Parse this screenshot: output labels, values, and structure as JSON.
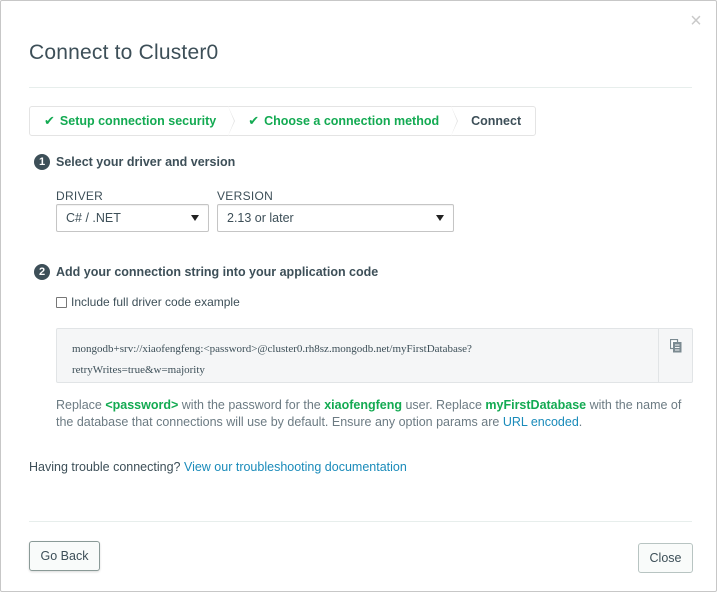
{
  "modal": {
    "title": "Connect to Cluster0",
    "close_glyph": "×"
  },
  "breadcrumb": {
    "items": [
      {
        "label": "Setup connection security",
        "done": true
      },
      {
        "label": "Choose a connection method",
        "done": true
      },
      {
        "label": "Connect",
        "done": false
      }
    ],
    "check_glyph": "✔"
  },
  "step1": {
    "number": "1",
    "label": "Select your driver and version",
    "driver_label": "DRIVER",
    "driver_value": "C# / .NET",
    "version_label": "VERSION",
    "version_value": "2.13 or later"
  },
  "step2": {
    "number": "2",
    "label": "Add your connection string into your application code",
    "checkbox_label": "Include full driver code example",
    "checkbox_checked": false,
    "connection_string_line1": "mongodb+srv://xiaofengfeng:<password>@cluster0.rh8sz.mongodb.net/myFirstDatabase?",
    "connection_string_line2": "retryWrites=true&w=majority",
    "copy_icon": "copy-icon"
  },
  "description": {
    "p1": "Replace ",
    "password_token": "<password>",
    "p2": " with the password for the ",
    "user": "xiaofengfeng",
    "p3": " user. Replace ",
    "db": "myFirstDatabase",
    "p4": " with the name of the database that connections will use by default. Ensure any option params are ",
    "url_link": "URL encoded",
    "p5": "."
  },
  "trouble": {
    "text": "Having trouble connecting? ",
    "link": "View our troubleshooting documentation"
  },
  "footer": {
    "back_label": "Go Back",
    "close_label": "Close"
  },
  "colors": {
    "green": "#13aa52",
    "link": "#1a8bba",
    "text": "#3d4f58"
  }
}
